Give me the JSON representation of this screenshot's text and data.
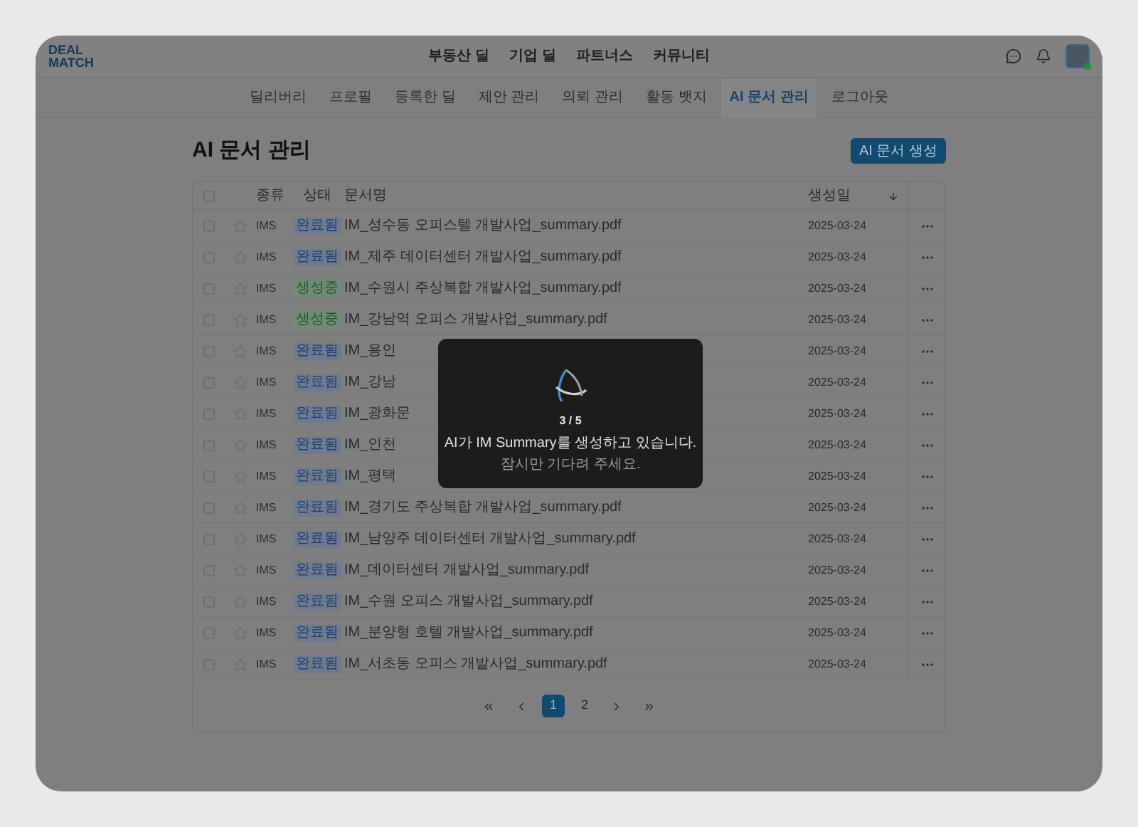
{
  "logo": {
    "lines": [
      "DEAL",
      "MATCH"
    ]
  },
  "top_nav": [
    "부동산 딜",
    "기업 딜",
    "파트너스",
    "커뮤니티"
  ],
  "user": {
    "online": true
  },
  "sub_nav": [
    {
      "label": "딜리버리",
      "selected": false
    },
    {
      "label": "프로필",
      "selected": false
    },
    {
      "label": "등록한 딜",
      "selected": false
    },
    {
      "label": "제안 관리",
      "selected": false
    },
    {
      "label": "의뢰 관리",
      "selected": false
    },
    {
      "label": "활동 뱃지",
      "selected": false
    },
    {
      "label": "AI 문서 관리",
      "selected": true
    },
    {
      "label": "로그아웃",
      "selected": false
    }
  ],
  "page_title": "AI 문서 관리",
  "create_button": "AI 문서 생성",
  "table": {
    "select_all": {
      "checked": false
    },
    "columns": [
      "종류",
      "상태",
      "문서명",
      "생성일"
    ],
    "rows": [
      {
        "checked": false,
        "starred": false,
        "type": "IMS",
        "status": {
          "label": "완료됨",
          "kind": "done"
        },
        "name": "IM_성수동 오피스텔 개발사업_summary.pdf",
        "date": "2025-03-24"
      },
      {
        "checked": false,
        "starred": false,
        "type": "IMS",
        "status": {
          "label": "완료됨",
          "kind": "done"
        },
        "name": "IM_제주 데이터센터 개발사업_summary.pdf",
        "date": "2025-03-24"
      },
      {
        "checked": false,
        "starred": false,
        "type": "IMS",
        "status": {
          "label": "생성중",
          "kind": "generating"
        },
        "name": "IM_수원시 주상복합 개발사업_summary.pdf",
        "date": "2025-03-24"
      },
      {
        "checked": false,
        "starred": false,
        "type": "IMS",
        "status": {
          "label": "생성중",
          "kind": "generating"
        },
        "name": "IM_강남역 오피스 개발사업_summary.pdf",
        "date": "2025-03-24"
      },
      {
        "checked": false,
        "starred": false,
        "type": "IMS",
        "status": {
          "label": "완료됨",
          "kind": "done"
        },
        "name": "IM_용인",
        "date": "2025-03-24"
      },
      {
        "checked": false,
        "starred": false,
        "type": "IMS",
        "status": {
          "label": "완료됨",
          "kind": "done"
        },
        "name": "IM_강남",
        "date": "2025-03-24"
      },
      {
        "checked": false,
        "starred": false,
        "type": "IMS",
        "status": {
          "label": "완료됨",
          "kind": "done"
        },
        "name": "IM_광화문",
        "date": "2025-03-24"
      },
      {
        "checked": false,
        "starred": false,
        "type": "IMS",
        "status": {
          "label": "완료됨",
          "kind": "done"
        },
        "name": "IM_인천",
        "date": "2025-03-24"
      },
      {
        "checked": false,
        "starred": false,
        "type": "IMS",
        "status": {
          "label": "완료됨",
          "kind": "done"
        },
        "name": "IM_평택",
        "date": "2025-03-24"
      },
      {
        "checked": false,
        "starred": false,
        "type": "IMS",
        "status": {
          "label": "완료됨",
          "kind": "done"
        },
        "name": "IM_경기도 주상복합 개발사업_summary.pdf",
        "date": "2025-03-24"
      },
      {
        "checked": false,
        "starred": false,
        "type": "IMS",
        "status": {
          "label": "완료됨",
          "kind": "done"
        },
        "name": "IM_남양주 데이터센터 개발사업_summary.pdf",
        "date": "2025-03-24"
      },
      {
        "checked": false,
        "starred": false,
        "type": "IMS",
        "status": {
          "label": "완료됨",
          "kind": "done"
        },
        "name": "IM_데이터센터 개발사업_summary.pdf",
        "date": "2025-03-24"
      },
      {
        "checked": false,
        "starred": false,
        "type": "IMS",
        "status": {
          "label": "완료됨",
          "kind": "done"
        },
        "name": "IM_수원 오피스 개발사업_summary.pdf",
        "date": "2025-03-24"
      },
      {
        "checked": false,
        "starred": false,
        "type": "IMS",
        "status": {
          "label": "완료됨",
          "kind": "done"
        },
        "name": "IM_분양형 호텔 개발사업_summary.pdf",
        "date": "2025-03-24"
      },
      {
        "checked": false,
        "starred": false,
        "type": "IMS",
        "status": {
          "label": "완료됨",
          "kind": "done"
        },
        "name": "IM_서초동 오피스 개발사업_summary.pdf",
        "date": "2025-03-24"
      }
    ]
  },
  "pagination": {
    "pages": [
      {
        "label": "1",
        "selected": true
      },
      {
        "label": "2",
        "selected": false
      }
    ]
  },
  "modal": {
    "progress": "3 / 5",
    "message": "AI가 IM Summary를 생성하고 있습니다.",
    "hint": "잠시만 기다려 주세요."
  }
}
